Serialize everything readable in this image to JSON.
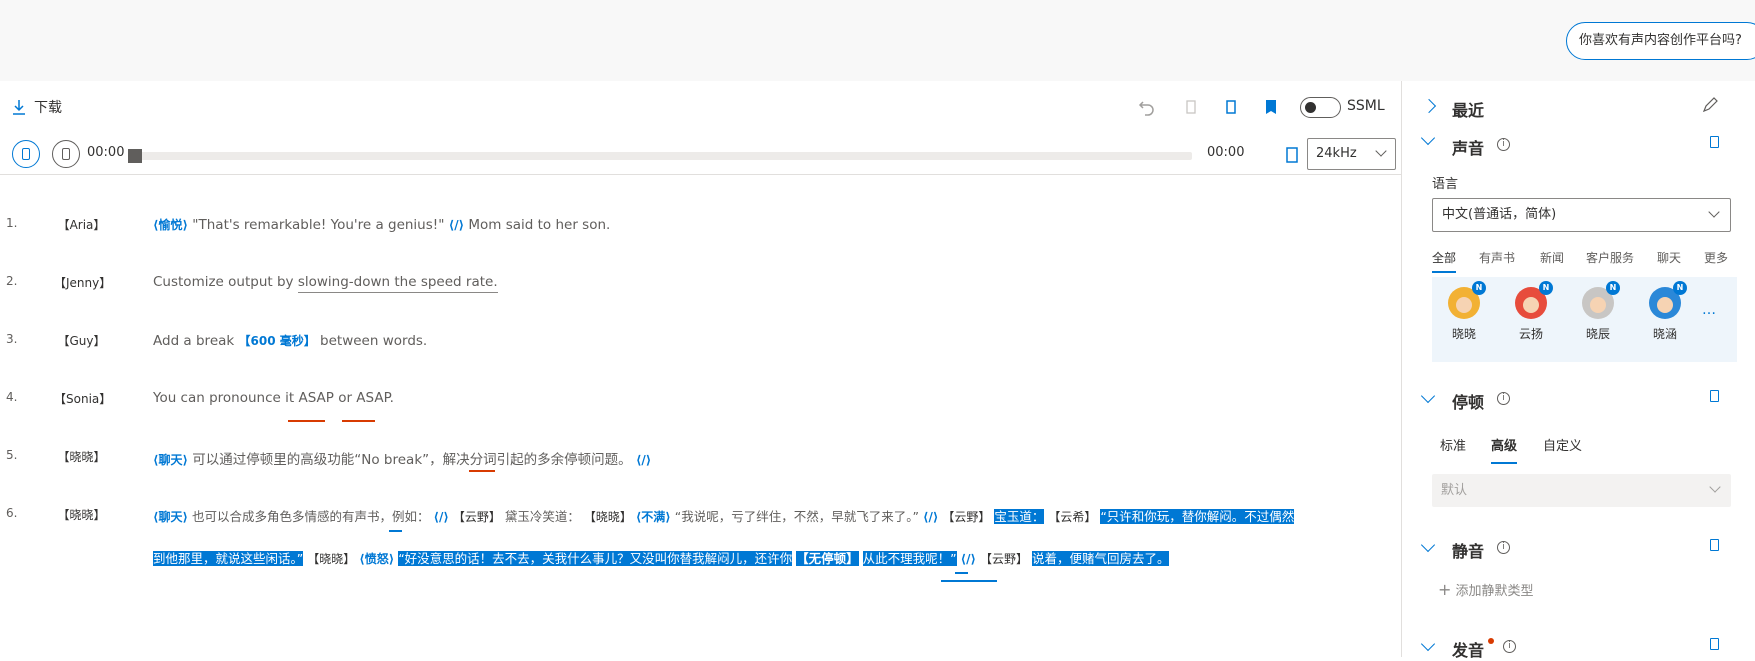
{
  "header": {
    "feedback_label": "你喜欢有声内容创作平台吗?"
  },
  "toolbar": {
    "download_label": "下载",
    "ssml_label": "SSML"
  },
  "player": {
    "current_time": "00:00",
    "total_time": "00:00",
    "sample_rate": "24kHz",
    "progress": 0
  },
  "editor": {
    "lines": [
      {
        "num": "1.",
        "speaker": "【Aria】",
        "tag": "⟨愉悦⟩",
        "text": "\"That's remarkable! You're a genius!\"",
        "end_tag": "⟨/⟩",
        "rest": "Mom said to her son."
      },
      {
        "num": "2.",
        "speaker": "【Jenny】",
        "pre": "Customize output by ",
        "underlined": "slowing-down the speed rate."
      },
      {
        "num": "3.",
        "speaker": "【Guy】",
        "pre": "Add a break",
        "tag": "【600 毫秒】",
        "post": "between words."
      },
      {
        "num": "4.",
        "speaker": "【Sonia】",
        "text": "You can pronounce it ASAP or ASAP."
      },
      {
        "num": "5.",
        "speaker": "【晓晓】",
        "tag": "⟨聊天⟩",
        "text": "可以通过停顿里的高级功能“No break”，解决分词引起的多余停顿问题。",
        "end_tag": "⟨/⟩"
      },
      {
        "num": "6.",
        "speaker": "【晓晓】",
        "row1": {
          "tag1": "⟨聊天⟩",
          "t1": "也可以合成多角色多情感的有声书，例如：",
          "end1": "⟨/⟩",
          "sp1": "【云野】",
          "t2": "黛玉冷笑道：",
          "sp2": "【晓晓】",
          "tag2": "⟨不满⟩",
          "t3": "“我说呢，亏了绊住，不然，早就飞了来了。”",
          "end2": "⟨/⟩",
          "sp3": "【云野】",
          "sel1": "宝玉道：",
          "sp4": "【云希】",
          "sel2": "“只许和你玩，替你解闷。不过偶然"
        },
        "row2": {
          "sel3": "到他那里，就说这些闲话。”",
          "sp5": "【晓晓】",
          "tag3": "⟨愤怒⟩",
          "sel4": "“好没意思的话！去不去，关我什么事儿？又没叫你替我解闷儿，还许你",
          "sel_tag": "【无停顿】",
          "sel5": "从此不理我呢！”",
          "end3": "⟨/⟩",
          "sp6": "【云野】",
          "sel6": "说着，便赌气回房去了。"
        }
      }
    ]
  },
  "panel": {
    "recent_title": "最近",
    "voice_title": "声音",
    "language_label": "语言",
    "language_value": "中文(普通话，简体)",
    "categories": [
      "全部",
      "有声书",
      "新闻",
      "客户服务",
      "聊天",
      "更多"
    ],
    "voices": [
      {
        "name": "晓晓",
        "badge": "N",
        "color": "#f2b134"
      },
      {
        "name": "云扬",
        "badge": "N",
        "color": "#e74c3c"
      },
      {
        "name": "晓辰",
        "badge": "N",
        "color": "#c8c6c4"
      },
      {
        "name": "晓涵",
        "badge": "N",
        "color": "#2b88d8"
      }
    ],
    "more_label": "…",
    "pause_title": "停顿",
    "pause_tabs": [
      "标准",
      "高级",
      "自定义"
    ],
    "pause_default": "默认",
    "silence_title": "静音",
    "add_silence_label": "添加静默类型",
    "pronunciation_title": "发音"
  }
}
